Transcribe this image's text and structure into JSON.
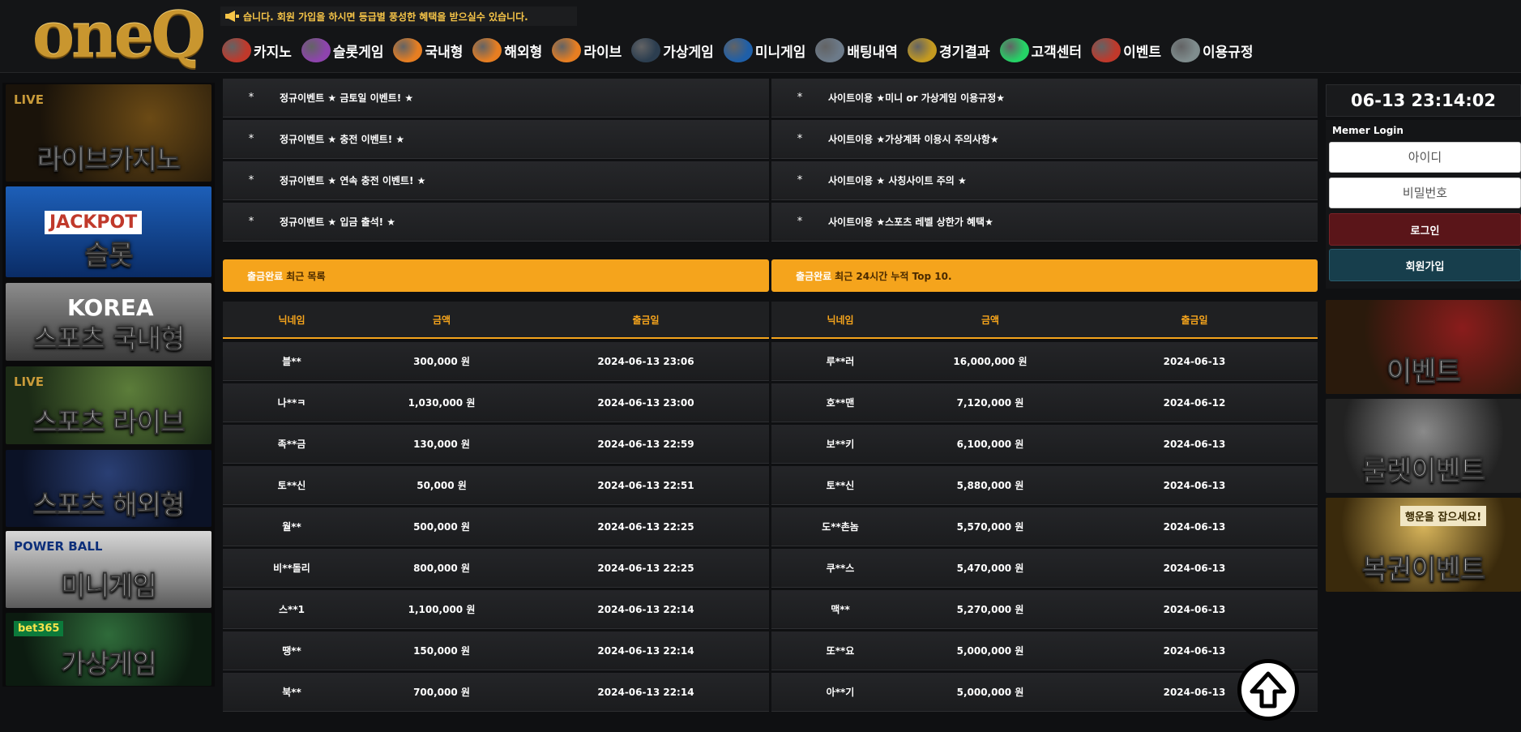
{
  "brand": {
    "logo_text": "oneQ"
  },
  "notice": {
    "text": "습니다.            회원 가입을 하시면 등급별 풍성한 혜택을 받으실수 있습니다."
  },
  "nav": [
    {
      "label": "카지노",
      "icon": "casino-icon",
      "color": "#c0392b"
    },
    {
      "label": "슬롯게임",
      "icon": "slot-icon",
      "color": "#8e44ad"
    },
    {
      "label": "국내형",
      "icon": "soccer-ball-icon",
      "color": "#e67e22"
    },
    {
      "label": "해외형",
      "icon": "soccer-ball-icon",
      "color": "#e67e22"
    },
    {
      "label": "라이브",
      "icon": "soccer-ball-icon",
      "color": "#e67e22"
    },
    {
      "label": "가상게임",
      "icon": "virtual-race-icon",
      "color": "#2c3e50"
    },
    {
      "label": "미니게임",
      "icon": "powerball-icon",
      "color": "#1f5fa8"
    },
    {
      "label": "배팅내역",
      "icon": "cards-icon",
      "color": "#6c7a89"
    },
    {
      "label": "경기결과",
      "icon": "trophy-icon",
      "color": "#c49a20"
    },
    {
      "label": "고객센터",
      "icon": "whatsapp-icon",
      "color": "#25d366"
    },
    {
      "label": "이벤트",
      "icon": "gift-icon",
      "color": "#c0392b"
    },
    {
      "label": "이용규정",
      "icon": "megaphone-icon",
      "color": "#7f8c8d"
    }
  ],
  "left_banners": [
    {
      "title": "라이브카지노",
      "badge": "LIVE"
    },
    {
      "title": "슬롯",
      "badge": "JACKPOT"
    },
    {
      "title": "스포츠 국내형",
      "badge": "KOREA"
    },
    {
      "title": "스포츠 라이브",
      "badge": "LIVE"
    },
    {
      "title": "스포츠 해외형",
      "badge": ""
    },
    {
      "title": "미니게임",
      "badge": "POWER BALL"
    },
    {
      "title": "가상게임",
      "badge": "bet365"
    }
  ],
  "events_board": [
    "정규이벤트 ★ 금토일 이벤트! ★",
    "정규이벤트 ★ 충전 이벤트! ★",
    "정규이벤트 ★ 연속 충전 이벤트! ★",
    "정규이벤트 ★ 입금 출석! ★"
  ],
  "rules_board": [
    "사이트이용 ★미니 or 가상게임 이용규정★",
    "사이트이용 ★가상계좌 이용시 주의사항★",
    "사이트이용 ★ 사칭사이트 주의 ★",
    "사이트이용 ★스포츠 레벨 상한가 혜택★"
  ],
  "bullet": "*",
  "recent_bar": {
    "strong": "출금완료",
    "sub": "최근 목록"
  },
  "top_bar": {
    "strong": "출금완료",
    "sub": "최근 24시간 누적 Top 10."
  },
  "recent_table": {
    "headers": [
      "닉네임",
      "금액",
      "출금일"
    ],
    "rows": [
      [
        "블**",
        "300,000 원",
        "2024-06-13 23:06"
      ],
      [
        "나**ㅋ",
        "1,030,000 원",
        "2024-06-13 23:00"
      ],
      [
        "족**금",
        "130,000 원",
        "2024-06-13 22:59"
      ],
      [
        "토**신",
        "50,000 원",
        "2024-06-13 22:51"
      ],
      [
        "월**",
        "500,000 원",
        "2024-06-13 22:25"
      ],
      [
        "비**돌리",
        "800,000 원",
        "2024-06-13 22:25"
      ],
      [
        "스**1",
        "1,100,000 원",
        "2024-06-13 22:14"
      ],
      [
        "땡**",
        "150,000 원",
        "2024-06-13 22:14"
      ],
      [
        "북**",
        "700,000 원",
        "2024-06-13 22:14"
      ]
    ]
  },
  "top_table": {
    "headers": [
      "닉네임",
      "금액",
      "출금일"
    ],
    "rows": [
      [
        "루**러",
        "16,000,000 원",
        "2024-06-13"
      ],
      [
        "호**맨",
        "7,120,000 원",
        "2024-06-12"
      ],
      [
        "보**키",
        "6,100,000 원",
        "2024-06-13"
      ],
      [
        "토**신",
        "5,880,000 원",
        "2024-06-13"
      ],
      [
        "도**촌놈",
        "5,570,000 원",
        "2024-06-13"
      ],
      [
        "쿠**스",
        "5,470,000 원",
        "2024-06-13"
      ],
      [
        "맥**",
        "5,270,000 원",
        "2024-06-13"
      ],
      [
        "또**요",
        "5,000,000 원",
        "2024-06-13"
      ],
      [
        "아**기",
        "5,000,000 원",
        "2024-06-13"
      ]
    ]
  },
  "clock": {
    "text": "06-13 23:14:02"
  },
  "login": {
    "title": "Memer Login",
    "id_placeholder": "아이디",
    "pw_placeholder": "비밀번호",
    "login_label": "로그인",
    "join_label": "회원가입"
  },
  "right_banners": [
    {
      "title": "이벤트"
    },
    {
      "title": "룰렛이벤트"
    },
    {
      "title": "복권이벤트",
      "badge": "행운을 잡으세요!"
    }
  ]
}
